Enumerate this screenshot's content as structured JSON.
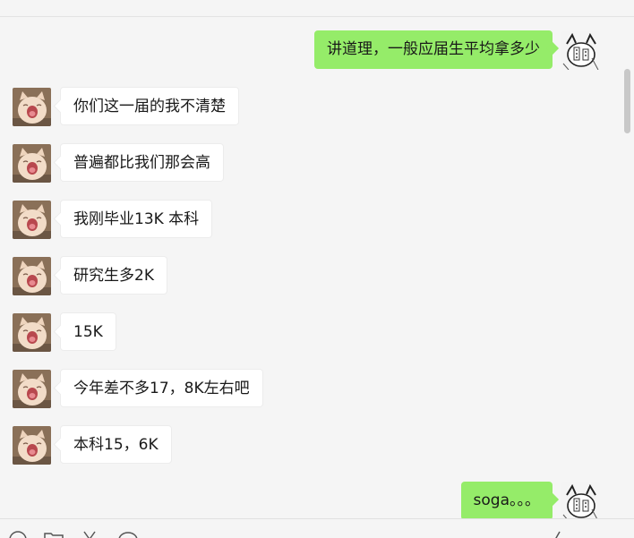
{
  "colors": {
    "background": "#f5f5f5",
    "incoming_bubble": "#ffffff",
    "outgoing_bubble": "#95ec69",
    "text": "#191919"
  },
  "messages": [
    {
      "direction": "outgoing",
      "text": "讲道理，一般应届生平均拿多少",
      "avatar": "manga-cat-avatar"
    },
    {
      "direction": "incoming",
      "text": "你们这一届的我不清楚",
      "avatar": "cat-yawning-avatar"
    },
    {
      "direction": "incoming",
      "text": "普遍都比我们那会高",
      "avatar": "cat-yawning-avatar"
    },
    {
      "direction": "incoming",
      "text": "我刚毕业13K 本科",
      "avatar": "cat-yawning-avatar"
    },
    {
      "direction": "incoming",
      "text": "研究生多2K",
      "avatar": "cat-yawning-avatar"
    },
    {
      "direction": "incoming",
      "text": "15K",
      "avatar": "cat-yawning-avatar"
    },
    {
      "direction": "incoming",
      "text": "今年差不多17，8K左右吧",
      "avatar": "cat-yawning-avatar"
    },
    {
      "direction": "incoming",
      "text": "本科15，6K",
      "avatar": "cat-yawning-avatar"
    },
    {
      "direction": "outgoing",
      "text": "soga。。。",
      "avatar": "manga-cat-avatar"
    }
  ],
  "toolbar_icons": [
    "emoji-icon",
    "folder-icon",
    "scissors-icon",
    "chat-history-icon",
    "microphone-icon"
  ]
}
